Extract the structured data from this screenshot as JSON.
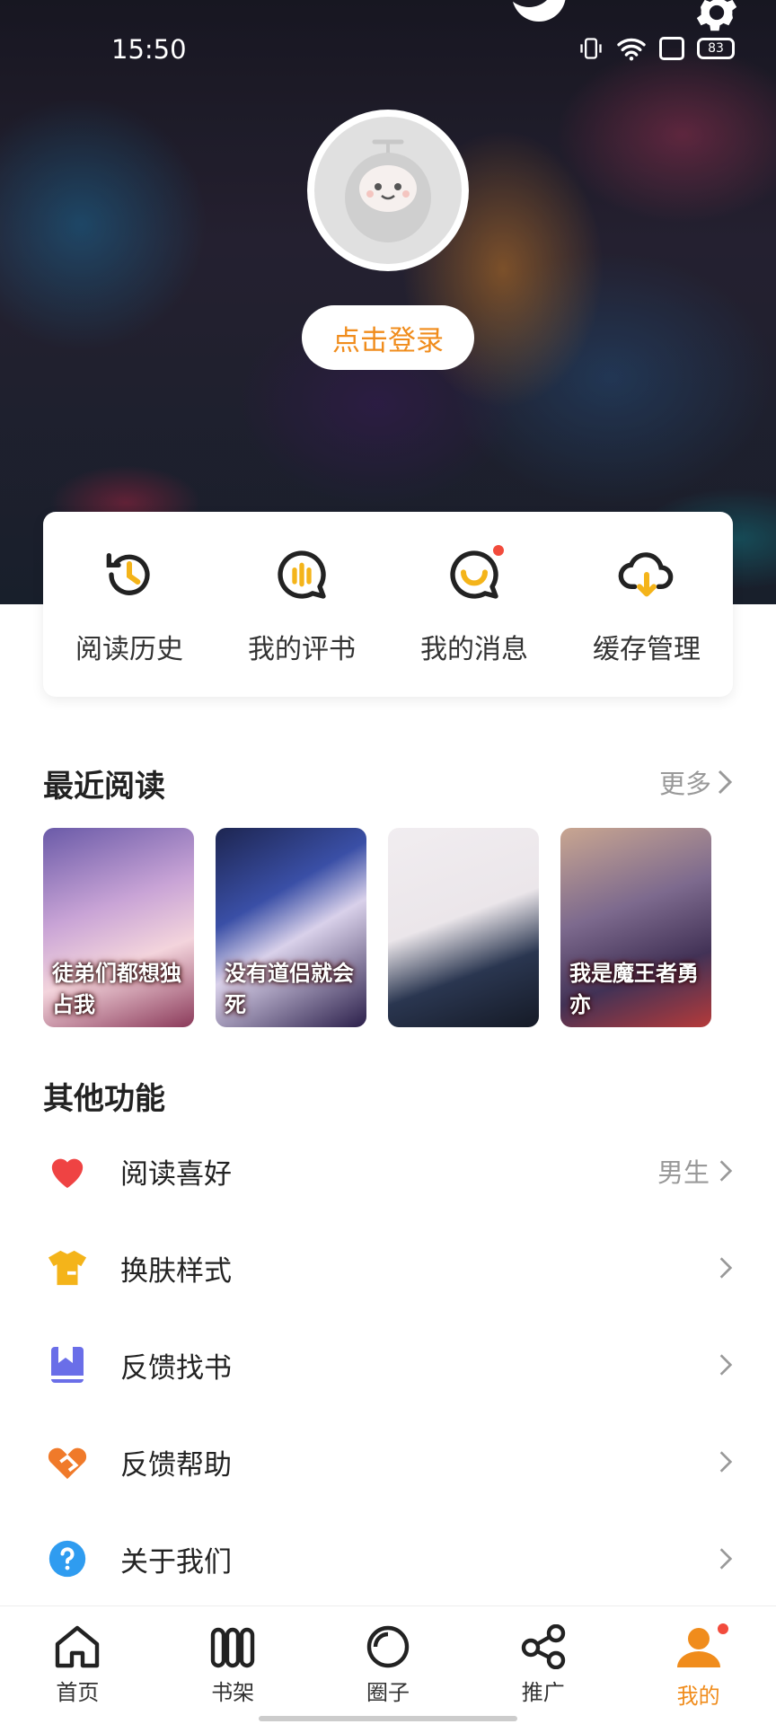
{
  "status": {
    "time": "15:50",
    "battery": "83"
  },
  "header": {
    "login_label": "点击登录"
  },
  "quick_actions": [
    {
      "label": "阅读历史",
      "icon": "history-clock-icon"
    },
    {
      "label": "我的评书",
      "icon": "review-bubble-icon"
    },
    {
      "label": "我的消息",
      "icon": "message-bubble-icon"
    },
    {
      "label": "缓存管理",
      "icon": "cloud-download-icon"
    }
  ],
  "recent": {
    "title": "最近阅读",
    "more_label": "更多",
    "books": [
      {
        "title": "徒弟们都想独占我"
      },
      {
        "title": "没有道侣就会死"
      },
      {
        "title": ""
      },
      {
        "title": "我是魔王者勇亦"
      }
    ]
  },
  "other": {
    "title": "其他功能",
    "items": [
      {
        "label": "阅读喜好",
        "value": "男生",
        "icon": "heart-icon",
        "color": "#ef4343"
      },
      {
        "label": "换肤样式",
        "value": "",
        "icon": "tshirt-icon",
        "color": "#f4b41a"
      },
      {
        "label": "反馈找书",
        "value": "",
        "icon": "book-icon",
        "color": "#6a6ee8"
      },
      {
        "label": "反馈帮助",
        "value": "",
        "icon": "handshake-icon",
        "color": "#f07a2a"
      },
      {
        "label": "关于我们",
        "value": "",
        "icon": "question-icon",
        "color": "#2f9cf0"
      }
    ]
  },
  "tabs": [
    {
      "label": "首页",
      "icon": "home-icon"
    },
    {
      "label": "书架",
      "icon": "bookshelf-icon"
    },
    {
      "label": "圈子",
      "icon": "circle-icon"
    },
    {
      "label": "推广",
      "icon": "share-icon"
    },
    {
      "label": "我的",
      "icon": "profile-icon",
      "active": true
    }
  ],
  "colors": {
    "accent": "#f08c1c",
    "badge": "#f24b3c"
  }
}
